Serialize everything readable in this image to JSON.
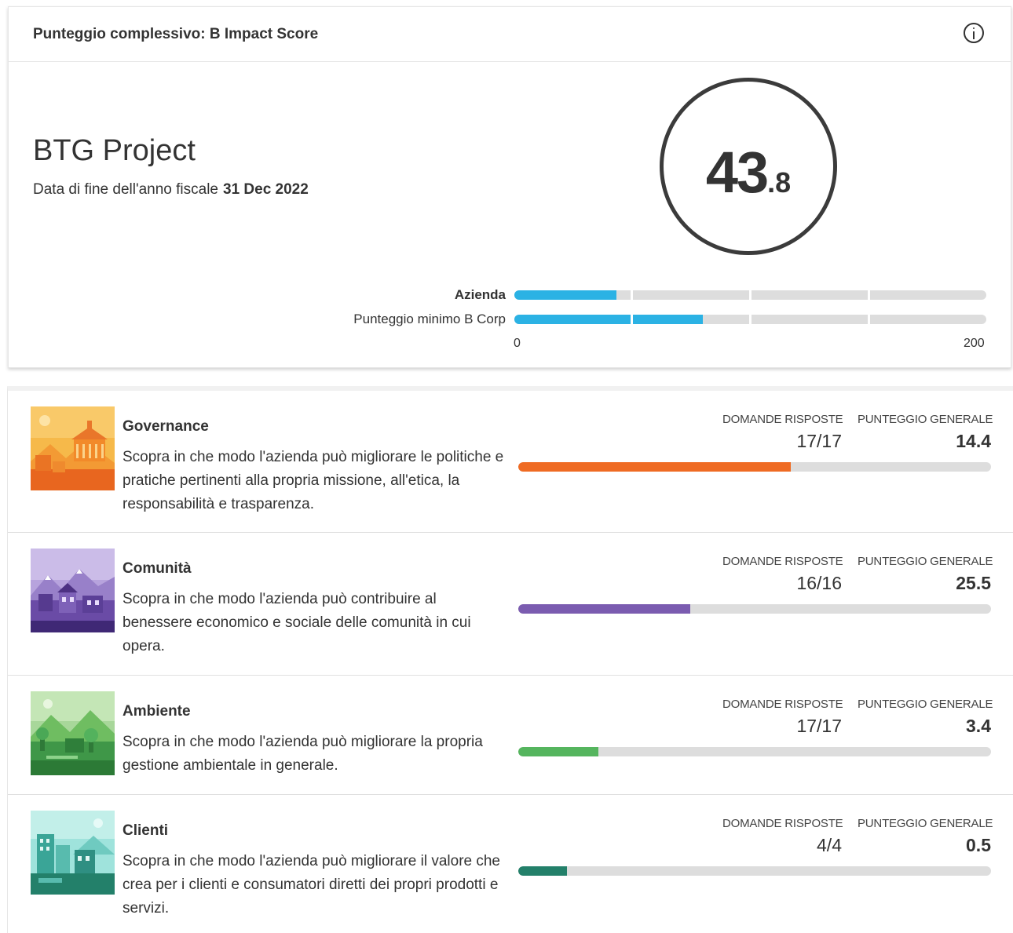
{
  "header": {
    "title": "Punteggio complessivo: B Impact Score",
    "info_icon": "info-icon"
  },
  "company": {
    "name": "BTG Project",
    "fiscal_label": "Data di fine dell'anno fiscale",
    "fiscal_date": "31 Dec 2022"
  },
  "score": {
    "integer": "43",
    "decimal": ".8"
  },
  "comparison": {
    "azienda_label": "Azienda",
    "azienda_value": 43.8,
    "minimum_label": "Punteggio minimo B Corp",
    "minimum_value": 80,
    "axis_min": "0",
    "axis_max": "200",
    "max_value": 200,
    "bar_color": "#2bb2e4"
  },
  "stat_headers": {
    "answered": "DOMANDE RISPOSTE",
    "overall": "PUNTEGGIO GENERALE"
  },
  "areas": [
    {
      "name": "Governance",
      "description": "Scopra in che modo l'azienda può migliorare le politiche e pratiche pertinenti alla propria missione, all'etica, la responsabilità e trasparenza.",
      "answered": "17/17",
      "score": "14.4",
      "progress": 0.577,
      "color": "#ef6b23"
    },
    {
      "name": "Comunità",
      "description": "Scopra in che modo l'azienda può contribuire al benessere economico e sociale delle comunità in cui opera.",
      "answered": "16/16",
      "score": "25.5",
      "progress": 0.364,
      "color": "#7b5cb0"
    },
    {
      "name": "Ambiente",
      "description": "Scopra in che modo l'azienda può migliorare la propria gestione ambientale in generale.",
      "answered": "17/17",
      "score": "3.4",
      "progress": 0.17,
      "color": "#55b55e"
    },
    {
      "name": "Clienti",
      "description": "Scopra in che modo l'azienda può migliorare il valore che crea per i clienti e consumatori diretti dei propri prodotti e servizi.",
      "answered": "4/4",
      "score": "0.5",
      "progress": 0.103,
      "color": "#23806a"
    }
  ]
}
